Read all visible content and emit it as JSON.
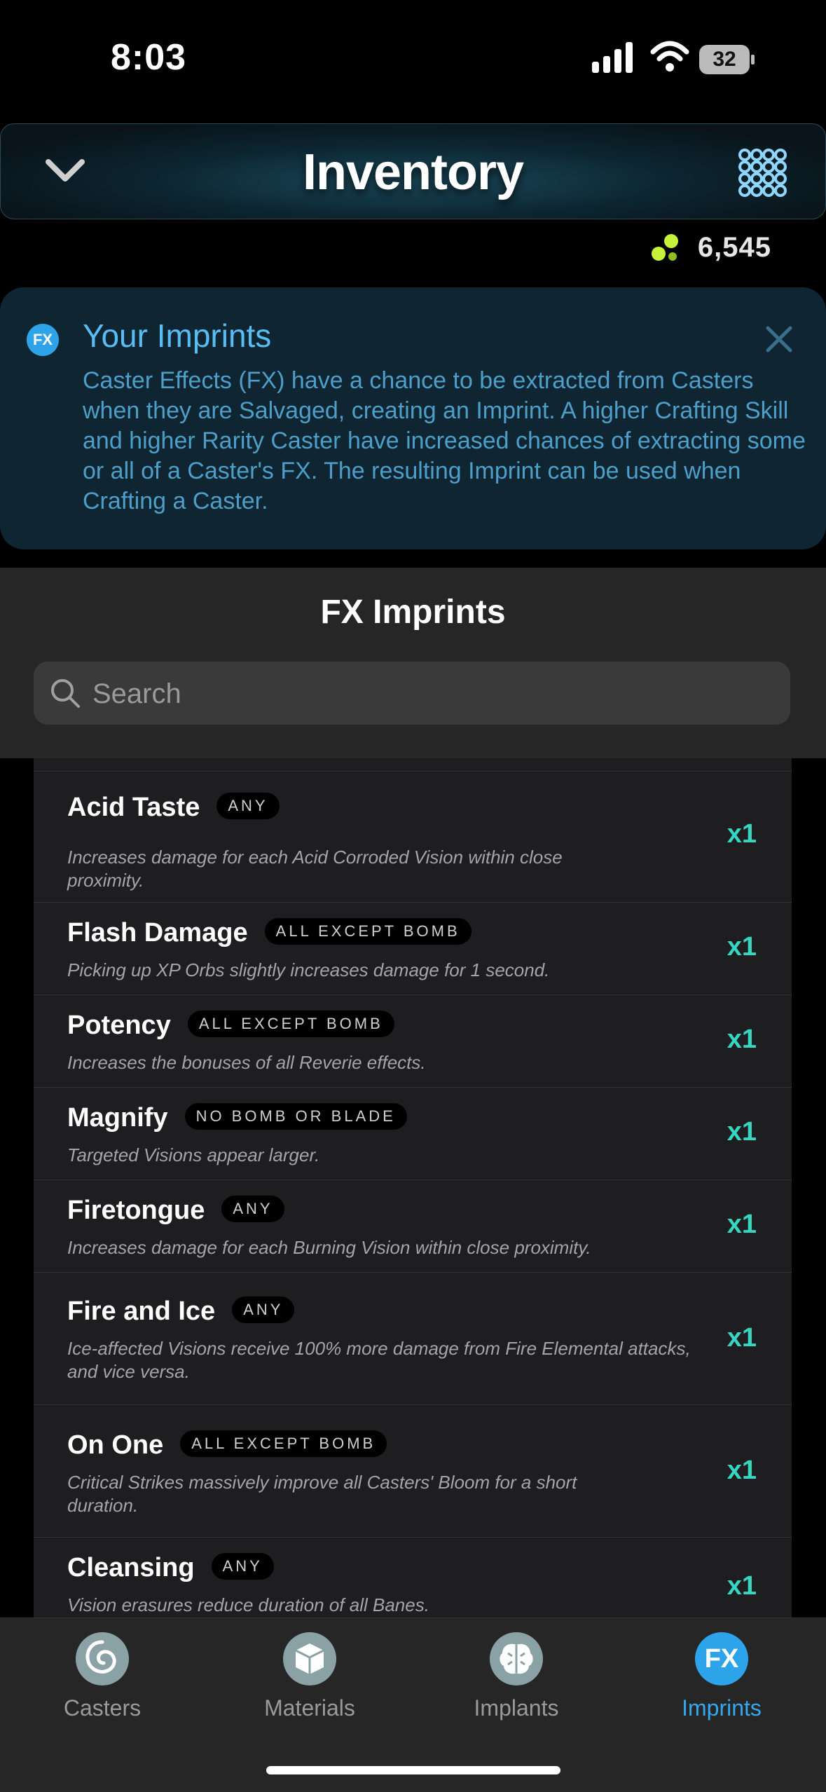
{
  "status_bar": {
    "time": "8:03",
    "battery": "32"
  },
  "header": {
    "title": "Inventory"
  },
  "currency": {
    "amount": "6,545",
    "accent": "#c6f23a"
  },
  "info": {
    "icon_label": "FX",
    "title": "Your Imprints",
    "text": "Caster Effects (FX) have a chance to be extracted from Casters when they are Salvaged, creating an Imprint. A higher Crafting Skill and higher Rarity Caster have increased chances of extracting some or all of a Caster's FX. The resulting Imprint can be used when Crafting a Caster."
  },
  "panel": {
    "title": "FX Imprints",
    "search_placeholder": "Search"
  },
  "items": [
    {
      "name": "Acid Taste",
      "tag": "ANY",
      "desc": "Increases damage for each Acid Corroded Vision within close proximity.",
      "qty": "x1"
    },
    {
      "name": "Flash Damage",
      "tag": "ALL EXCEPT BOMB",
      "desc": "Picking up XP Orbs slightly increases damage for 1 second.",
      "qty": "x1"
    },
    {
      "name": "Potency",
      "tag": "ALL EXCEPT BOMB",
      "desc": "Increases the bonuses of all Reverie effects.",
      "qty": "x1"
    },
    {
      "name": "Magnify",
      "tag": "NO BOMB OR BLADE",
      "desc": "Targeted Visions appear larger.",
      "qty": "x1"
    },
    {
      "name": "Firetongue",
      "tag": "ANY",
      "desc": "Increases damage for each Burning Vision within close proximity.",
      "qty": "x1"
    },
    {
      "name": "Fire and Ice",
      "tag": "ANY",
      "desc": "Ice-affected Visions receive 100% more damage from Fire Elemental attacks, and vice versa.",
      "qty": "x1"
    },
    {
      "name": "On One",
      "tag": "ALL EXCEPT BOMB",
      "desc": "Critical Strikes massively improve all Casters' Bloom for a short duration.",
      "qty": "x1"
    },
    {
      "name": "Cleansing",
      "tag": "ANY",
      "desc": "Vision erasures reduce duration of all Banes.",
      "qty": "x1"
    }
  ],
  "tabs": [
    {
      "label": "Casters",
      "icon": "swirl-icon"
    },
    {
      "label": "Materials",
      "icon": "box-icon"
    },
    {
      "label": "Implants",
      "icon": "brain-icon"
    },
    {
      "label": "Imprints",
      "icon": "fx-icon",
      "icon_text": "FX",
      "active": true
    }
  ]
}
